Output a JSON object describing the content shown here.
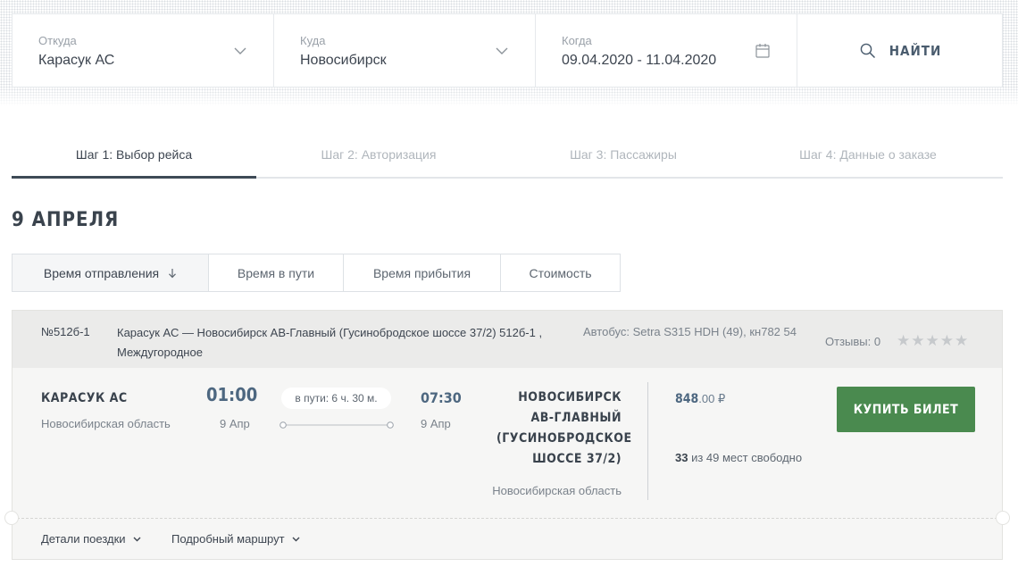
{
  "search": {
    "from_label": "Откуда",
    "from_value": "Карасук АС",
    "to_label": "Куда",
    "to_value": "Новосибирск",
    "when_label": "Когда",
    "when_value": "09.04.2020 - 11.04.2020",
    "button_label": "НАЙТИ"
  },
  "steps": [
    {
      "label": "Шаг 1: Выбор рейса",
      "active": true
    },
    {
      "label": "Шаг 2: Авторизация",
      "active": false
    },
    {
      "label": "Шаг 3: Пассажиры",
      "active": false
    },
    {
      "label": "Шаг 4: Данные о заказе",
      "active": false
    }
  ],
  "date_title": "9 АПРЕЛЯ",
  "sort": {
    "tabs": [
      "Время отправления",
      "Время в пути",
      "Время прибытия",
      "Стоимость"
    ],
    "active_icon": "arrow-down-icon"
  },
  "trip": {
    "number": "№512б-1",
    "route": "Карасук АС — Новосибирск АВ-Главный (Гусинобродское шоссе 37/2) 512б-1 , Междугородное",
    "bus": "Автобус: Setra S315 HDH (49), кн782 54",
    "reviews": "Отзывы: 0",
    "rating": 0,
    "rating_max": 5,
    "origin_name": "КАРАСУК АС",
    "origin_region": "Новосибирская область",
    "dep_time": "01:00",
    "dep_date": "9 Апр",
    "duration": "в пути: 6 ч. 30 м.",
    "arr_time": "07:30",
    "arr_date": "9 Апр",
    "dest_name": "НОВОСИБИРСК АВ-ГЛАВНЫЙ (ГУСИНОБРОДСКОЕ ШОССЕ 37/2)",
    "dest_region": "Новосибирская область",
    "price_main": "848",
    "price_cents": ".00 ₽",
    "seats_free": "33",
    "seats_text": " из 49 мест свободно",
    "buy_label": "КУПИТЬ БИЛЕТ",
    "details_label": "Детали поездки",
    "route_label": "Подробный маршрут"
  },
  "colors": {
    "accent_green": "#4a8a4f",
    "time_blue": "#4d6780",
    "text_dark": "#3d4550"
  }
}
